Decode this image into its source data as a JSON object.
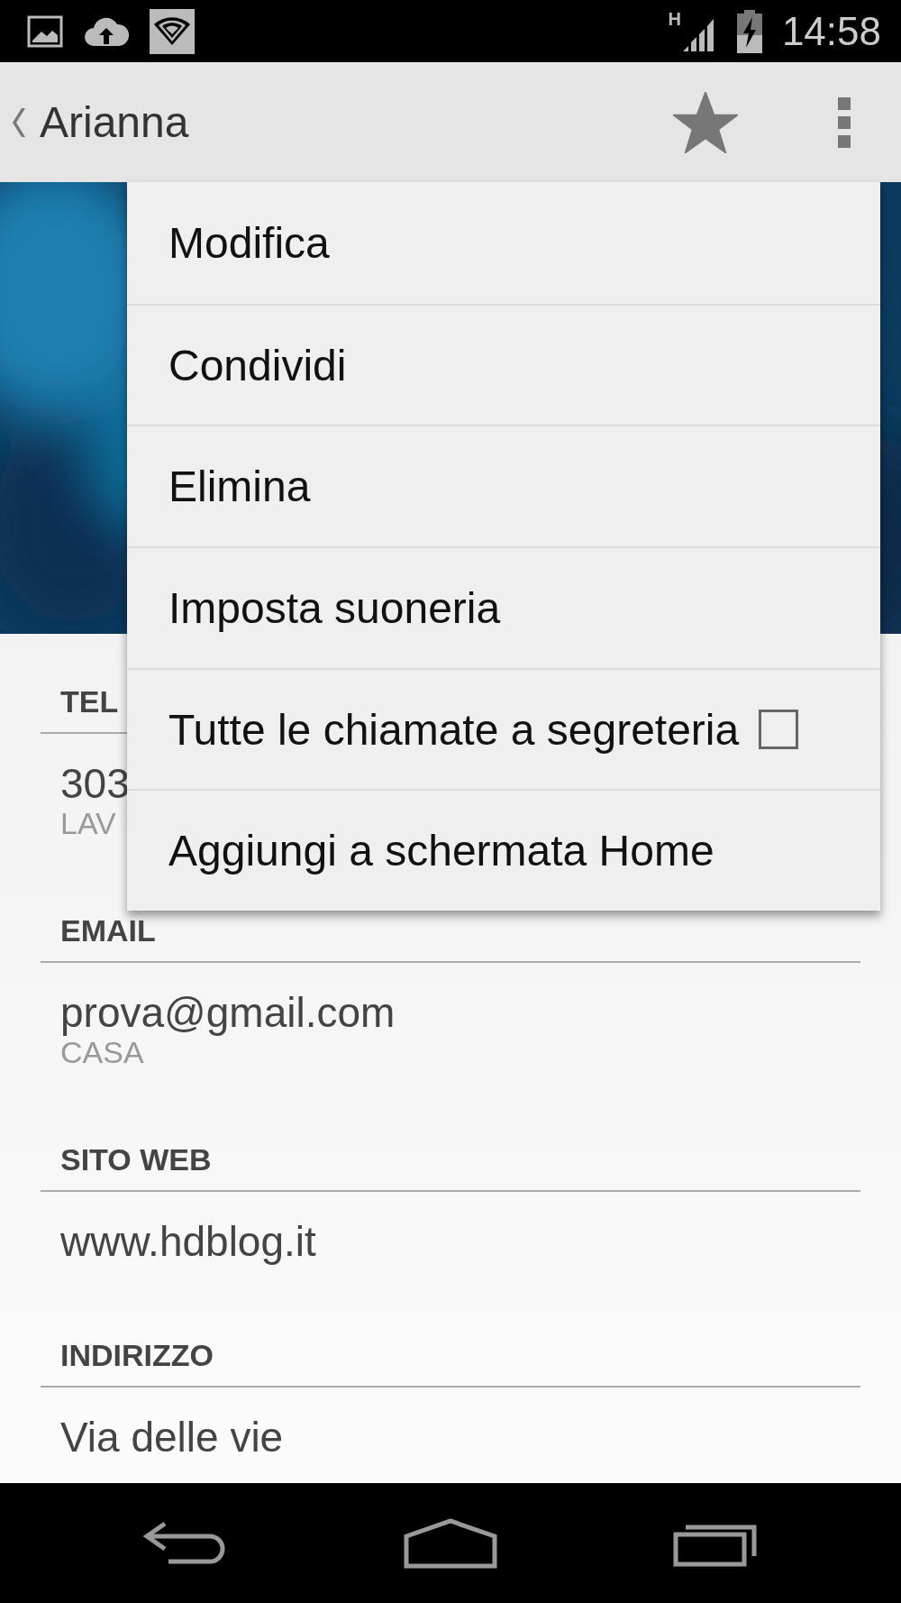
{
  "status_bar": {
    "network_type": "H",
    "time": "14:58"
  },
  "app_bar": {
    "title": "Arianna",
    "starred": true
  },
  "menu": {
    "items": [
      {
        "kind": "action",
        "label": "Modifica"
      },
      {
        "kind": "action",
        "label": "Condividi"
      },
      {
        "kind": "action",
        "label": "Elimina"
      },
      {
        "kind": "action",
        "label": "Imposta suoneria"
      },
      {
        "kind": "checkbox",
        "label": "Tutte le chiamate a segreteria",
        "checked": false
      },
      {
        "kind": "action",
        "label": "Aggiungi a schermata Home"
      }
    ]
  },
  "sections": [
    {
      "header": "TEL",
      "entries": [
        {
          "value": "303",
          "type": "LAV"
        }
      ]
    },
    {
      "header": "EMAIL",
      "entries": [
        {
          "value": "prova@gmail.com",
          "type": "CASA"
        }
      ]
    },
    {
      "header": "SITO WEB",
      "entries": [
        {
          "value": "www.hdblog.it"
        }
      ]
    },
    {
      "header": "INDIRIZZO",
      "entries": [
        {
          "value": "Via delle vie"
        }
      ]
    }
  ]
}
